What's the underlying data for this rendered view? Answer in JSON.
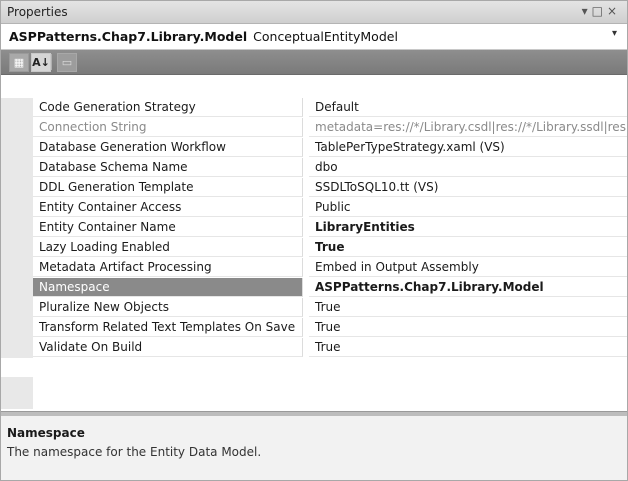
{
  "window": {
    "title": "Properties",
    "ctrl_dropdown": "▾",
    "ctrl_maximize": "□",
    "ctrl_close": "×"
  },
  "object_selector": {
    "name": "ASPPatterns.Chap7.Library.Model",
    "type": "ConceptualEntityModel",
    "arrow": "▾"
  },
  "toolbar": {
    "categorized_glyph": "▦",
    "alphabetical_glyph": "A↓",
    "property_pages_glyph": "▭"
  },
  "properties": [
    {
      "name": "Code Generation Strategy",
      "value": "Default",
      "state": "normal"
    },
    {
      "name": "Connection String",
      "value": "metadata=res://*/Library.csdl|res://*/Library.ssdl|res:",
      "state": "disabled"
    },
    {
      "name": "Database Generation Workflow",
      "value": "TablePerTypeStrategy.xaml (VS)",
      "state": "normal"
    },
    {
      "name": "Database Schema Name",
      "value": "dbo",
      "state": "normal"
    },
    {
      "name": "DDL Generation Template",
      "value": "SSDLToSQL10.tt (VS)",
      "state": "normal"
    },
    {
      "name": "Entity Container Access",
      "value": "Public",
      "state": "normal"
    },
    {
      "name": "Entity Container Name",
      "value": "LibraryEntities",
      "state": "bold"
    },
    {
      "name": "Lazy Loading Enabled",
      "value": "True",
      "state": "bold"
    },
    {
      "name": "Metadata Artifact Processing",
      "value": "Embed in Output Assembly",
      "state": "normal"
    },
    {
      "name": "Namespace",
      "value": "ASPPatterns.Chap7.Library.Model",
      "state": "selected-bold"
    },
    {
      "name": "Pluralize New Objects",
      "value": "True",
      "state": "normal"
    },
    {
      "name": "Transform Related Text Templates On Save",
      "value": "True",
      "state": "normal"
    },
    {
      "name": "Validate On Build",
      "value": "True",
      "state": "normal"
    }
  ],
  "description": {
    "title": "Namespace",
    "text": "The namespace for the Entity Data Model."
  }
}
